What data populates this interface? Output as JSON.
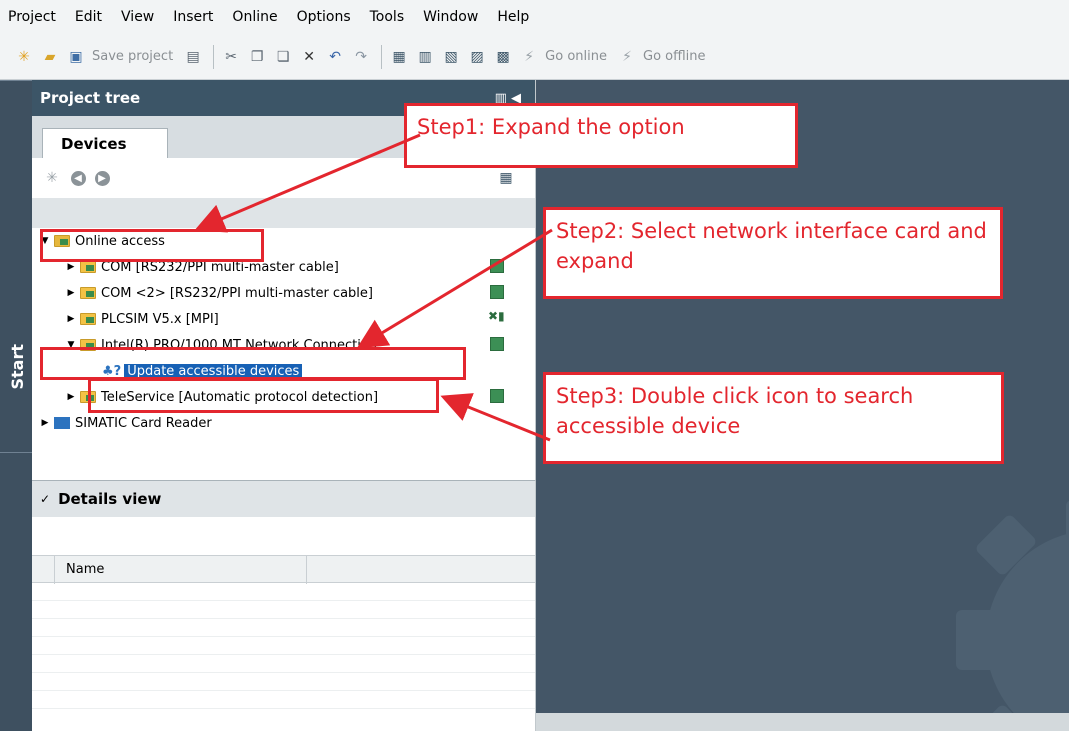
{
  "menu": [
    "Project",
    "Edit",
    "View",
    "Insert",
    "Online",
    "Options",
    "Tools",
    "Window",
    "Help"
  ],
  "toolbar": {
    "save_label": "Save project",
    "go_online_label": "Go online",
    "go_offline_label": "Go offline"
  },
  "sidebar": {
    "start_label": "Start"
  },
  "project_tree": {
    "title": "Project tree",
    "tab": "Devices",
    "items": [
      {
        "label": "Online access",
        "expanded": true,
        "level": 0
      },
      {
        "label": "COM [RS232/PPI multi-master cable]",
        "expanded": false,
        "level": 1
      },
      {
        "label": "COM <2> [RS232/PPI multi-master cable]",
        "expanded": false,
        "level": 1
      },
      {
        "label": "PLCSIM V5.x [MPI]",
        "expanded": false,
        "level": 1
      },
      {
        "label": "Intel(R) PRO/1000 MT Network Connection",
        "expanded": true,
        "level": 1
      },
      {
        "label": "Update accessible devices",
        "selected": true,
        "level": 2
      },
      {
        "label": "TeleService [Automatic protocol detection]",
        "expanded": false,
        "level": 1
      },
      {
        "label": "SIMATIC Card Reader",
        "expanded": false,
        "level": 0
      }
    ]
  },
  "details_view": {
    "title": "Details view",
    "columns": [
      "Name"
    ]
  },
  "annotations": {
    "step1": "Step1: Expand the option",
    "step2": "Step2: Select network interface card and expand",
    "step3": "Step3: Double click icon to search accessible device",
    "color": "#e3262e"
  }
}
